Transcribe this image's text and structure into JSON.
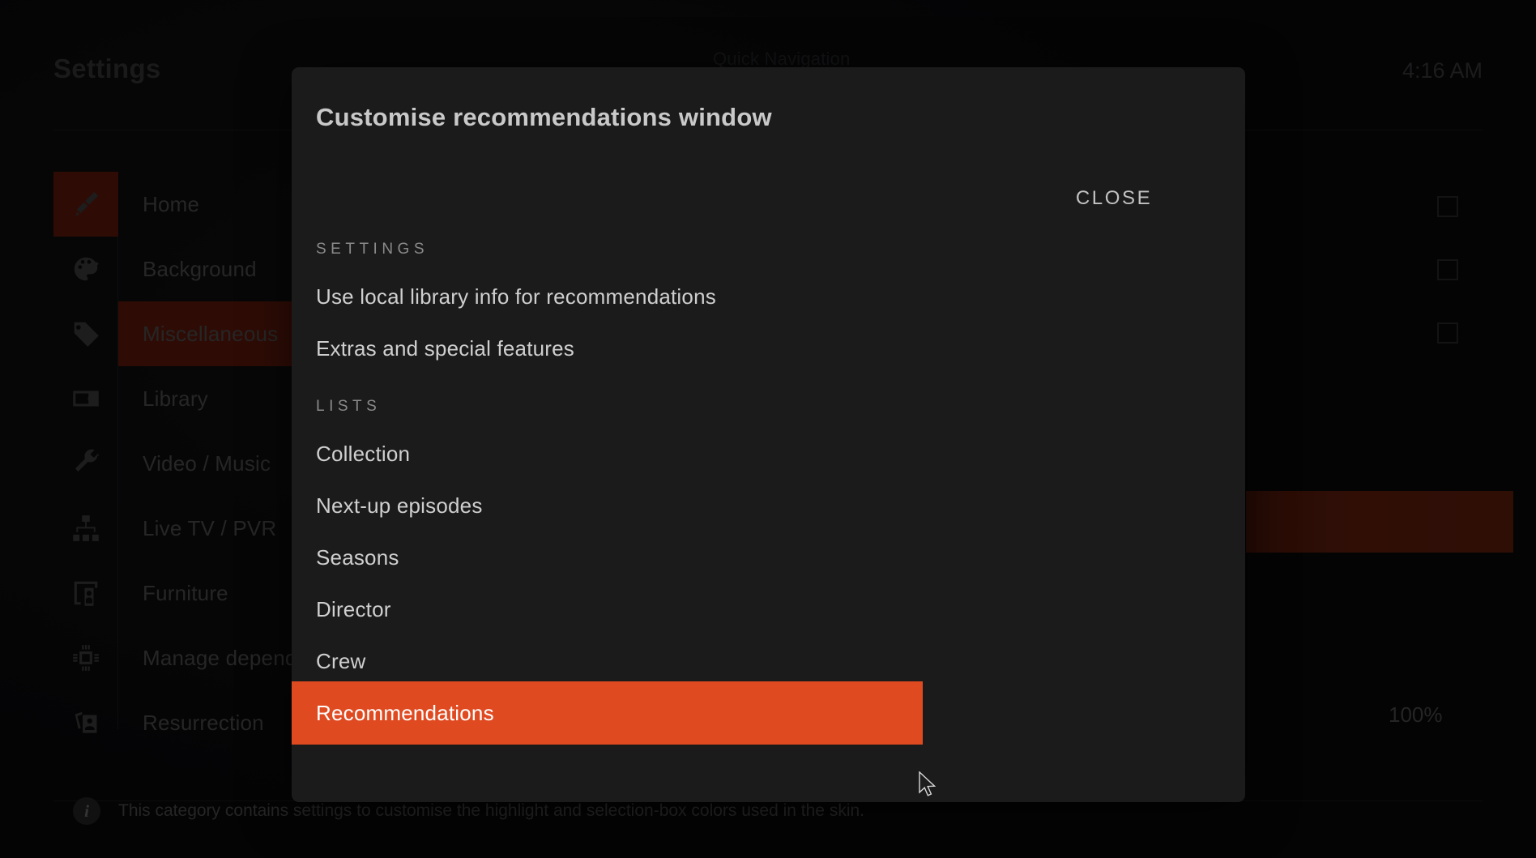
{
  "app": {
    "page_title": "Settings",
    "clock": "4:16 AM",
    "background_center_label": "Quick Navigation",
    "zoom_value": "100%"
  },
  "sidebar": {
    "items": [
      {
        "label": "Home",
        "icon": "paintbrush-icon",
        "selected": true
      },
      {
        "label": "Background",
        "icon": "palette-icon",
        "selected": false
      },
      {
        "label": "Miscellaneous",
        "icon": "tag-icon",
        "selected": true
      },
      {
        "label": "Library",
        "icon": "media-box-icon",
        "selected": false
      },
      {
        "label": "Video / Music",
        "icon": "wrench-icon",
        "selected": false
      },
      {
        "label": "Live TV / PVR",
        "icon": "sitemap-icon",
        "selected": false
      },
      {
        "label": "Furniture",
        "icon": "remote-cast-icon",
        "selected": false
      },
      {
        "label": "Manage dependencies",
        "icon": "cpu-chip-icon",
        "selected": false
      },
      {
        "label": "Resurrection",
        "icon": "photo-card-icon",
        "selected": false
      }
    ]
  },
  "info_bar": {
    "icon": "info-icon",
    "text": "This category contains settings to customise the highlight and selection-box colors used in the skin."
  },
  "dialog": {
    "title": "Customise recommendations window",
    "close_label": "CLOSE",
    "groups": [
      {
        "heading": "SETTINGS",
        "options": [
          {
            "label": "Use local library info for recommendations",
            "checked": false,
            "selected": false
          },
          {
            "label": "Extras and special features",
            "checked": true,
            "selected": false
          }
        ]
      },
      {
        "heading": "LISTS",
        "options": [
          {
            "label": "Collection",
            "checked": false,
            "selected": false
          },
          {
            "label": "Next-up episodes",
            "checked": false,
            "selected": false
          },
          {
            "label": "Seasons",
            "checked": false,
            "selected": false
          },
          {
            "label": "Director",
            "checked": false,
            "selected": false
          },
          {
            "label": "Crew",
            "checked": false,
            "selected": false
          },
          {
            "label": "Recommendations",
            "checked": false,
            "selected": true
          }
        ]
      }
    ],
    "scrollbar": {
      "color": "#e8491f"
    }
  },
  "colors": {
    "accent_orange": "#e04a20",
    "scrollbar_orange": "#e8491f",
    "selection_dark_red": "#4a1408",
    "dialog_bg": "#1b1b1c",
    "page_bg": "#0a0a0b"
  }
}
